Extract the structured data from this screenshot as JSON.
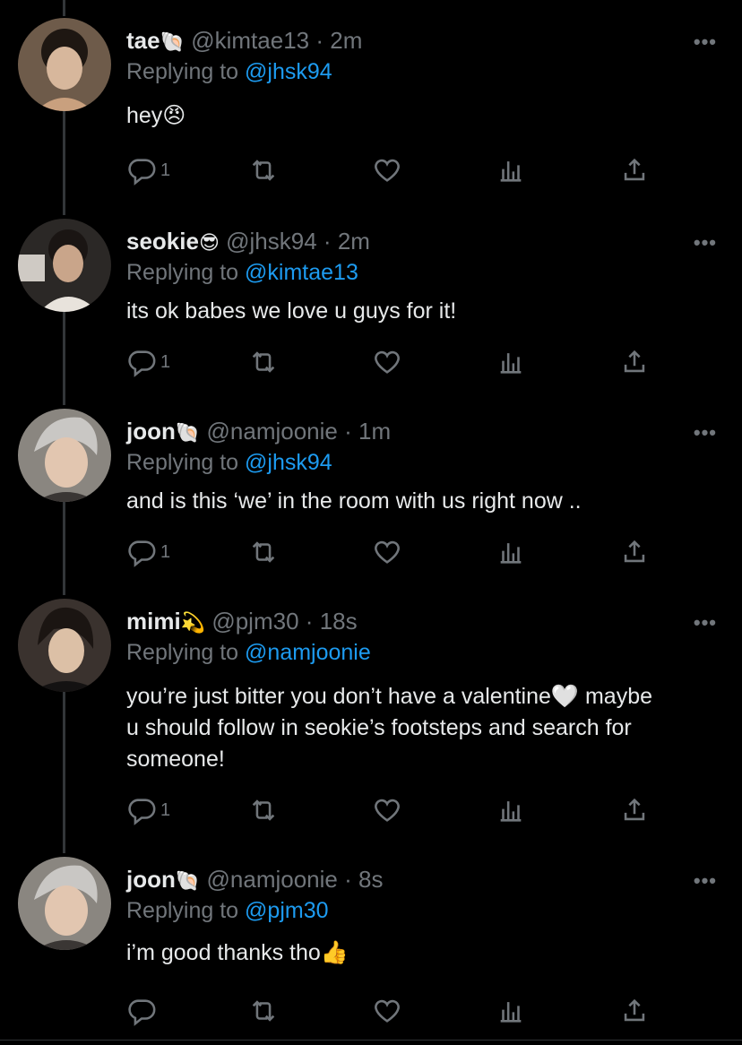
{
  "tweets": [
    {
      "name": "tae",
      "name_emoji": "🐚",
      "handle": "@kimtae13",
      "time": "2m",
      "replying_prefix": "Replying to",
      "replying_to": "@jhsk94",
      "text_lines": [
        "hey😠"
      ],
      "reply_count": "1",
      "avatar_color": "#5a4a3a"
    },
    {
      "name": "seokie",
      "name_emoji": "😎",
      "handle": "@jhsk94",
      "time": "2m",
      "replying_prefix": "Replying to",
      "replying_to": "@kimtae13",
      "text_lines": [
        "its ok babes we love u guys for it!"
      ],
      "reply_count": "1",
      "avatar_color": "#3b3633"
    },
    {
      "name": "joon",
      "name_emoji": "🐚",
      "handle": "@namjoonie",
      "time": "1m",
      "replying_prefix": "Replying to",
      "replying_to": "@jhsk94",
      "text_lines": [
        "and is this ‘we’ in the room with us right now .."
      ],
      "reply_count": "1",
      "avatar_color": "#9a9590"
    },
    {
      "name": "mimi",
      "name_emoji": "💫",
      "handle": "@pjm30",
      "time": "18s",
      "replying_prefix": "Replying to",
      "replying_to": "@namjoonie",
      "text_lines": [
        "you’re just bitter you don’t have a valentine🤍  maybe",
        "u should follow in seokie’s footsteps and search for",
        "someone!"
      ],
      "reply_count": "1",
      "avatar_color": "#4a3f3a"
    },
    {
      "name": "joon",
      "name_emoji": "🐚",
      "handle": "@namjoonie",
      "time": "8s",
      "replying_prefix": "Replying to",
      "replying_to": "@pjm30",
      "text_lines": [
        "i’m good thanks tho👍"
      ],
      "reply_count": "",
      "avatar_color": "#9a9590"
    }
  ],
  "icons": {
    "reply": "reply-icon",
    "retweet": "retweet-icon",
    "like": "heart-icon",
    "analytics": "analytics-icon",
    "share": "share-icon",
    "more": "more-icon"
  },
  "colors": {
    "background": "#000000",
    "text": "#e7e9ea",
    "muted": "#71767b",
    "link": "#1d9bf0"
  },
  "more_glyph": "•••",
  "separator": "·"
}
